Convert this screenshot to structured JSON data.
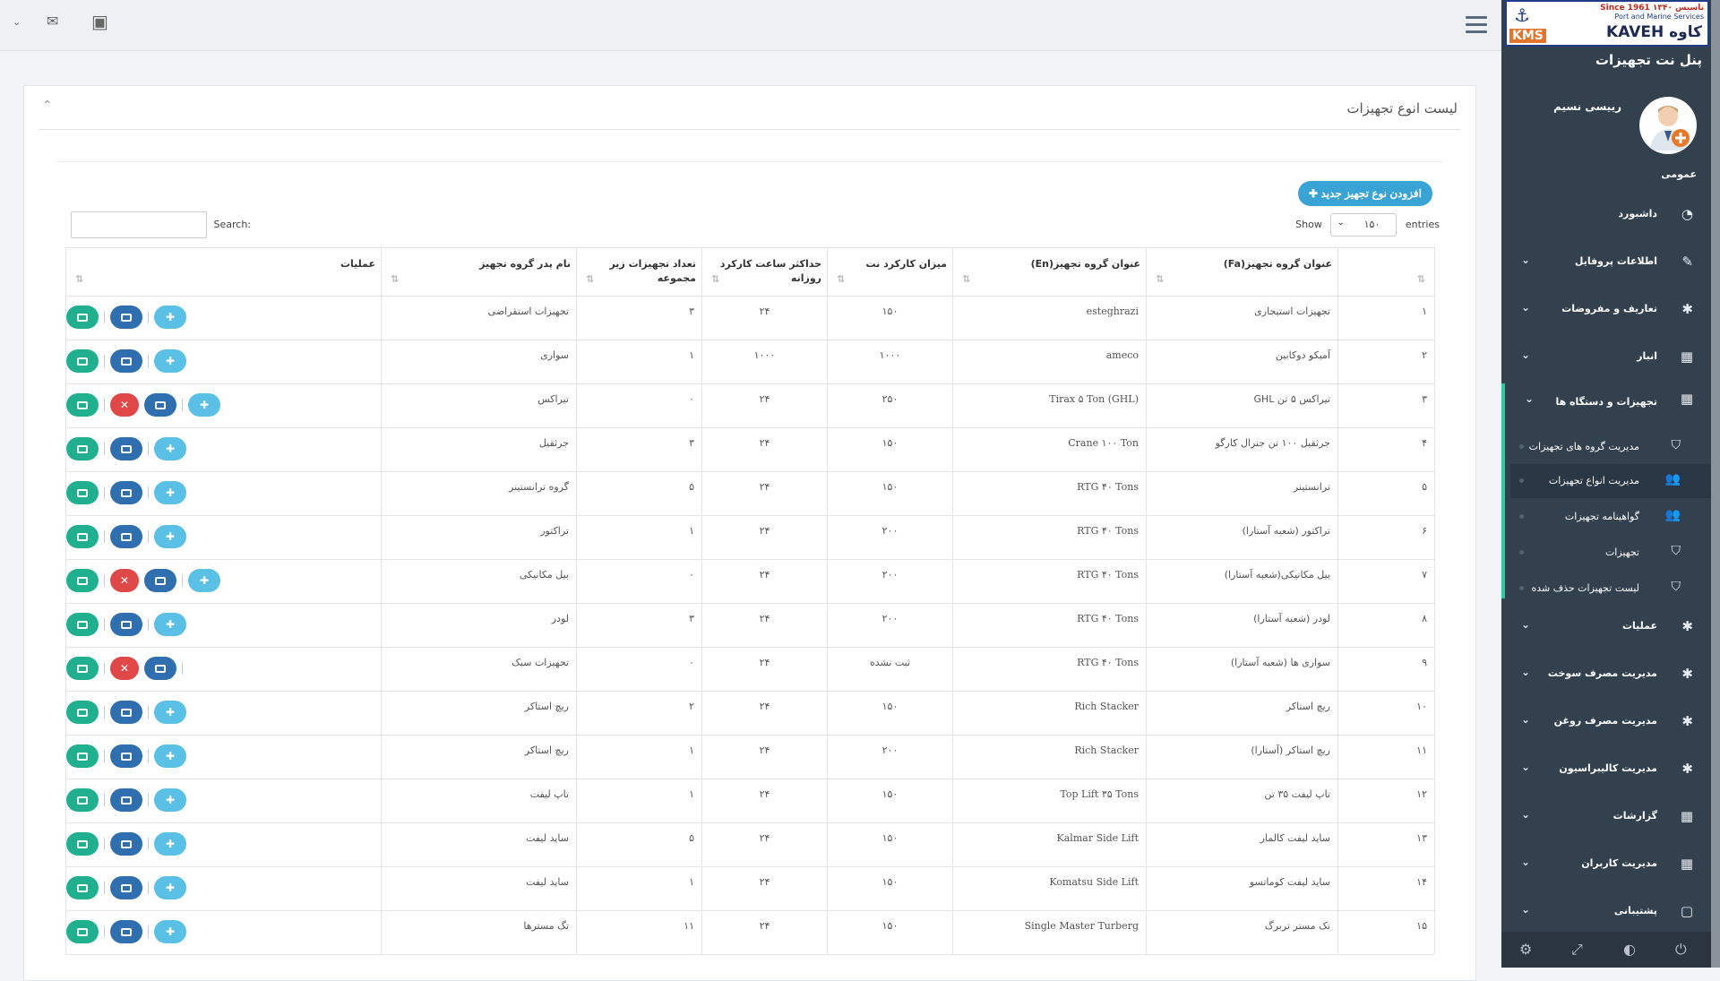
{
  "sidebar": {
    "logo": {
      "since": "Since 1961  ۱۳۴۰ تاسیس",
      "tagline": "Port and Marine Services",
      "name": "KAVEH کاوه",
      "badge": "KMS"
    },
    "panel_title": "پنل نت تجهیزات",
    "username": "رییسی نسیم",
    "section": "عمومی",
    "items": [
      {
        "label": "داشبورد",
        "icon": "dashboard-icon",
        "glyph": "◔",
        "chevron": false
      },
      {
        "label": "اطلاعات پروفایل",
        "icon": "edit-icon",
        "glyph": "✎",
        "chevron": true
      },
      {
        "label": "تعاریف و مفروضات",
        "icon": "bug-icon",
        "glyph": "✱",
        "chevron": true
      },
      {
        "label": "انبار",
        "icon": "table-icon",
        "glyph": "▦",
        "chevron": true
      },
      {
        "label": "تجهیزات و دستگاه ها",
        "icon": "table-icon",
        "glyph": "▦",
        "chevron": true,
        "active": true
      }
    ],
    "subitems": [
      {
        "label": "مدیریت گروه های تجهیزات",
        "icon": "shield-icon",
        "glyph": "⛉"
      },
      {
        "label": "مدیریت انواع تجهیزات",
        "icon": "users-icon",
        "glyph": "👥",
        "current": true
      },
      {
        "label": "گواهینامه تجهیزات",
        "icon": "users-icon",
        "glyph": "👥"
      },
      {
        "label": "تجهیزات",
        "icon": "shield-icon",
        "glyph": "⛉"
      },
      {
        "label": "لیست تجهیزات حذف شده",
        "icon": "shield-icon",
        "glyph": "⛉"
      }
    ],
    "items2": [
      {
        "label": "عملیات",
        "icon": "bug-icon",
        "glyph": "✱"
      },
      {
        "label": "مدیریت مصرف سوخت",
        "icon": "bug-icon",
        "glyph": "✱"
      },
      {
        "label": "مدیریت مصرف روغن",
        "icon": "bug-icon",
        "glyph": "✱"
      },
      {
        "label": "مدیریت کالیبراسیون",
        "icon": "bug-icon",
        "glyph": "✱"
      },
      {
        "label": "گزارشات",
        "icon": "table-icon",
        "glyph": "▦"
      },
      {
        "label": "مدیریت کاربران",
        "icon": "table-icon",
        "glyph": "▦"
      },
      {
        "label": "پشتیبانی",
        "icon": "image-icon",
        "glyph": "▢"
      }
    ]
  },
  "panel": {
    "title": "لیست انوع تجهیزات",
    "add_button": "✚ افزودن نوع تجهیز جدید",
    "show_label": "Show",
    "show_value": "۱۵۰",
    "entries_label": "entries",
    "search_label": "Search:"
  },
  "table": {
    "headers": [
      "",
      "عنوان گروه تجهیز(Fa)",
      "عنوان گروه تجهیز(En)",
      "میزان کارکرد نت",
      "حداکثر ساعت کارکرد روزانه",
      "تعداد تجهیزات زیر مجموعه",
      "نام پدر گروه تجهیز",
      "عملیات"
    ],
    "rows": [
      {
        "n": "۱",
        "fa": "تجهیزات استیجاری",
        "en": "esteghrazi",
        "net": "۱۵۰",
        "max": "۲۴",
        "cnt": "۳",
        "parent": "تجهیزات استقراضی",
        "del": false,
        "add": true
      },
      {
        "n": "۲",
        "fa": "آمیکو دوکابین",
        "en": "ameco",
        "net": "۱۰۰۰",
        "max": "۱۰۰۰",
        "cnt": "۱",
        "parent": "سواری",
        "del": false,
        "add": true
      },
      {
        "n": "۳",
        "fa": "تیراکس ۵ تن GHL",
        "en": "Tirax ۵ Ton (GHL)",
        "net": "۲۵۰",
        "max": "۲۴",
        "cnt": "۰",
        "parent": "تیراکس",
        "del": true,
        "add": true
      },
      {
        "n": "۴",
        "fa": "جرثقیل ۱۰۰ تن جنرال کارگو",
        "en": "Crane ۱۰۰ Ton",
        "net": "۱۵۰",
        "max": "۲۴",
        "cnt": "۳",
        "parent": "جرثقیل",
        "del": false,
        "add": true
      },
      {
        "n": "۵",
        "fa": "ترانستینر",
        "en": "RTG ۴۰ Tons",
        "net": "۱۵۰",
        "max": "۲۴",
        "cnt": "۵",
        "parent": "گروه ترانستینر",
        "del": false,
        "add": true
      },
      {
        "n": "۶",
        "fa": "تراکتور (شعبه آستارا)",
        "en": "RTG ۴۰ Tons",
        "net": "۲۰۰",
        "max": "۲۴",
        "cnt": "۱",
        "parent": "تراکتور",
        "del": false,
        "add": true
      },
      {
        "n": "۷",
        "fa": "بیل مکانیکی(شعبه آستارا)",
        "en": "RTG ۴۰ Tons",
        "net": "۲۰۰",
        "max": "۲۴",
        "cnt": "۰",
        "parent": "بیل مکانیکی",
        "del": true,
        "add": true
      },
      {
        "n": "۸",
        "fa": "لودر (شعبه آستارا)",
        "en": "RTG ۴۰ Tons",
        "net": "۲۰۰",
        "max": "۲۴",
        "cnt": "۳",
        "parent": "لودر",
        "del": false,
        "add": true
      },
      {
        "n": "۹",
        "fa": "سواری ها (شعبه آستارا)",
        "en": "RTG ۴۰ Tons",
        "net": "ثبت نشده",
        "max": "۲۴",
        "cnt": "۰",
        "parent": "تجهیزات سبک",
        "del": true,
        "add": false
      },
      {
        "n": "۱۰",
        "fa": "ریچ استاکر",
        "en": "Rich Stacker",
        "net": "۱۵۰",
        "max": "۲۴",
        "cnt": "۲",
        "parent": "ریچ استاکر",
        "del": false,
        "add": true
      },
      {
        "n": "۱۱",
        "fa": "ریچ استاکر (آستارا)",
        "en": "Rich Stacker",
        "net": "۲۰۰",
        "max": "۲۴",
        "cnt": "۱",
        "parent": "ریچ استاکر",
        "del": false,
        "add": true
      },
      {
        "n": "۱۲",
        "fa": "تاپ لیفت ۳۵ تن",
        "en": "Top Lift ۳۵ Tons",
        "net": "۱۵۰",
        "max": "۲۴",
        "cnt": "۱",
        "parent": "تاپ لیفت",
        "del": false,
        "add": true
      },
      {
        "n": "۱۳",
        "fa": "ساید لیفت کالمار",
        "en": "Kalmar Side Lift",
        "net": "۱۵۰",
        "max": "۲۴",
        "cnt": "۵",
        "parent": "ساید لیفت",
        "del": false,
        "add": true
      },
      {
        "n": "۱۴",
        "fa": "ساید لیفت کوماتسو",
        "en": "Komatsu Side Lift",
        "net": "۱۵۰",
        "max": "۲۴",
        "cnt": "۱",
        "parent": "ساید لیفت",
        "del": false,
        "add": true
      },
      {
        "n": "۱۵",
        "fa": "تک مستر تربرگ",
        "en": "Single Master Turberg",
        "net": "۱۵۰",
        "max": "۲۴",
        "cnt": "۱۱",
        "parent": "تگ مسترها",
        "del": false,
        "add": true
      }
    ]
  },
  "colors": {
    "sidebar": "#33414f",
    "edit": "#21b08f",
    "list": "#2f6fb0",
    "delete": "#e04848",
    "add": "#5ac0e6",
    "primary": "#3aa3d6"
  }
}
